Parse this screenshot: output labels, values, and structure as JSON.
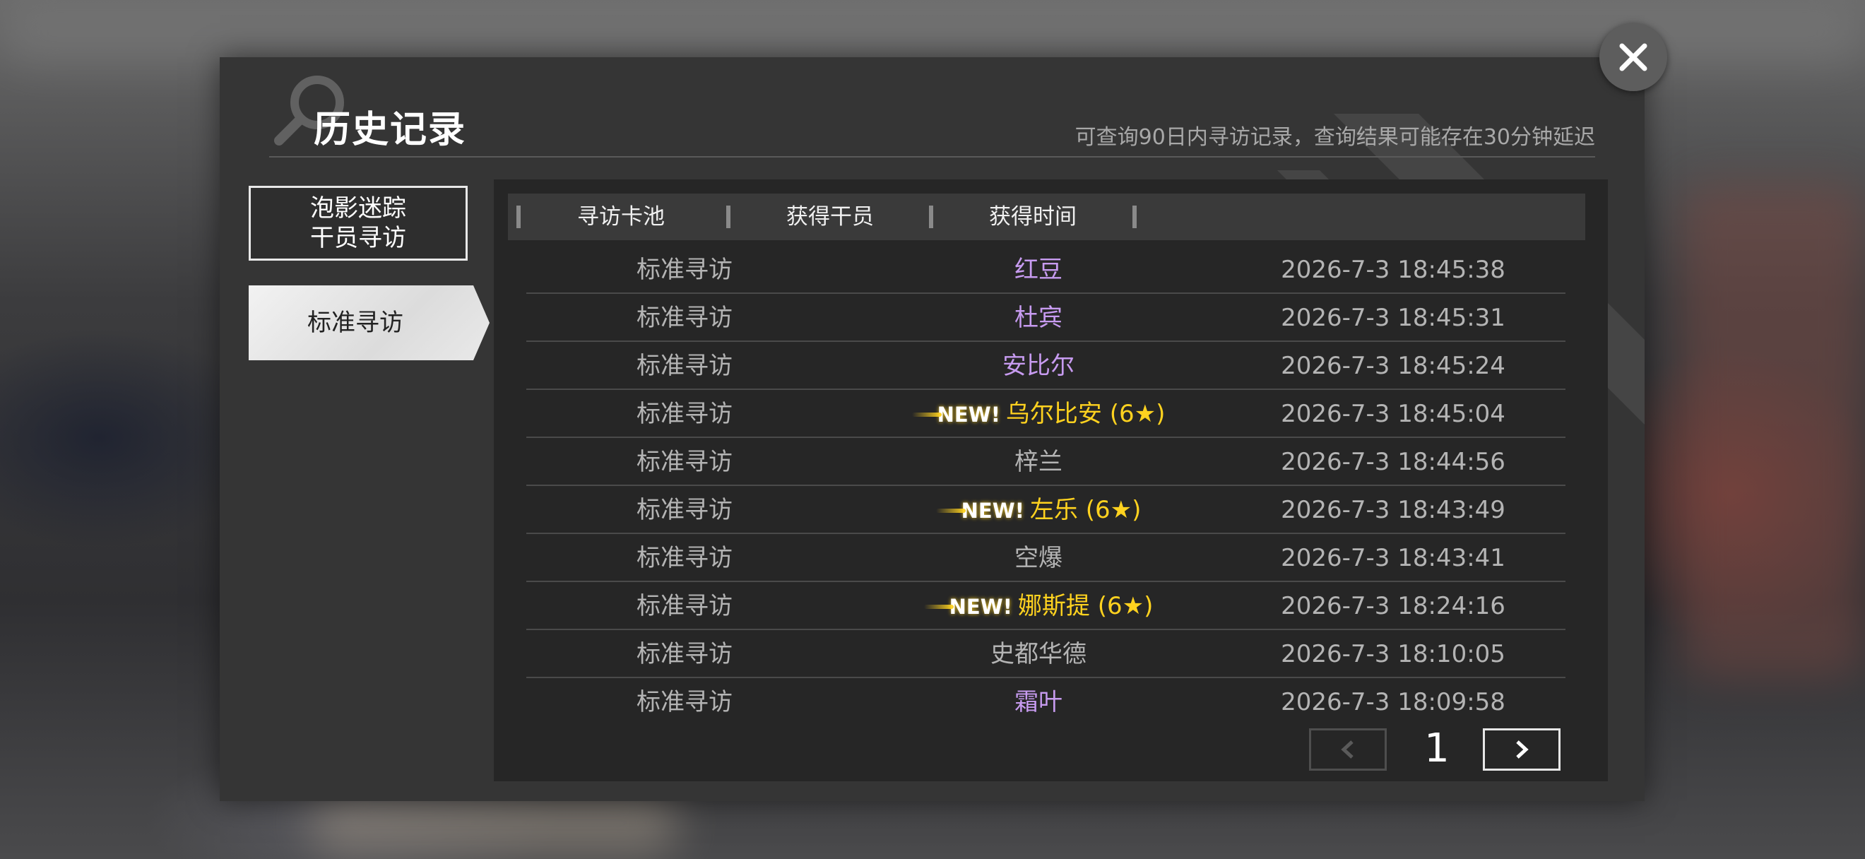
{
  "dialog": {
    "title": "历史记录",
    "subtitle": "可查询90日内寻访记录，查询结果可能存在30分钟延迟"
  },
  "tabs": [
    {
      "line1": "泡影迷踪",
      "line2": "干员寻访",
      "selected": false
    },
    {
      "label": "标准寻访",
      "selected": true
    }
  ],
  "table": {
    "headers": [
      "寻访卡池",
      "获得干员",
      "获得时间"
    ],
    "rows": [
      {
        "pool": "标准寻访",
        "operator": "红豆",
        "new": false,
        "rarity_color": "#c79bf0",
        "time": "2026-7-3 18:45:38"
      },
      {
        "pool": "标准寻访",
        "operator": "杜宾",
        "new": false,
        "rarity_color": "#c79bf0",
        "time": "2026-7-3 18:45:31"
      },
      {
        "pool": "标准寻访",
        "operator": "安比尔",
        "new": false,
        "rarity_color": "#c79bf0",
        "time": "2026-7-3 18:45:24"
      },
      {
        "pool": "标准寻访",
        "operator": "乌尔比安 (6★)",
        "new": true,
        "new_label": "NEW!",
        "rarity_color": "#ffd21f",
        "time": "2026-7-3 18:45:04"
      },
      {
        "pool": "标准寻访",
        "operator": "梓兰",
        "new": false,
        "rarity_color": "#b4b4b4",
        "time": "2026-7-3 18:44:56"
      },
      {
        "pool": "标准寻访",
        "operator": "左乐 (6★)",
        "new": true,
        "new_label": "NEW!",
        "rarity_color": "#ffd21f",
        "time": "2026-7-3 18:43:49"
      },
      {
        "pool": "标准寻访",
        "operator": "空爆",
        "new": false,
        "rarity_color": "#b4b4b4",
        "time": "2026-7-3 18:43:41"
      },
      {
        "pool": "标准寻访",
        "operator": "娜斯提 (6★)",
        "new": true,
        "new_label": "NEW!",
        "rarity_color": "#ffd21f",
        "time": "2026-7-3 18:24:16"
      },
      {
        "pool": "标准寻访",
        "operator": "史都华德",
        "new": false,
        "rarity_color": "#b4b4b4",
        "time": "2026-7-3 18:10:05"
      },
      {
        "pool": "标准寻访",
        "operator": "霜叶",
        "new": false,
        "rarity_color": "#c79bf0",
        "time": "2026-7-3 18:09:58"
      }
    ]
  },
  "pager": {
    "page": "1",
    "prev_icon": "chevron-left-icon",
    "next_icon": "chevron-right-icon",
    "prev_enabled": false,
    "next_enabled": true
  },
  "close_icon": "close-icon"
}
